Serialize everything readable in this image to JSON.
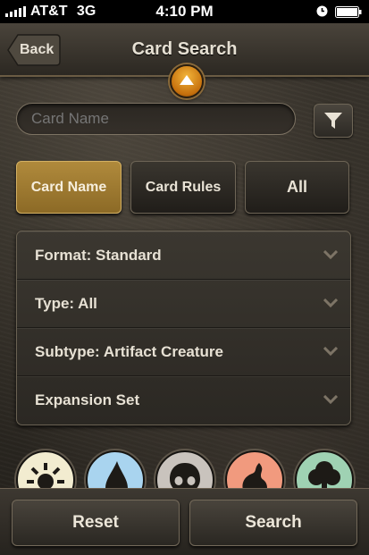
{
  "status_bar": {
    "carrier": "AT&T",
    "network": "3G",
    "time": "4:10 PM"
  },
  "nav": {
    "back_label": "Back",
    "title": "Card Search"
  },
  "search": {
    "placeholder": "Card Name"
  },
  "segments": [
    {
      "label": "Card Name",
      "selected": true
    },
    {
      "label": "Card Rules",
      "selected": false
    },
    {
      "label": "All",
      "selected": false
    }
  ],
  "filters": [
    {
      "label": "Format: Standard"
    },
    {
      "label": "Type: All"
    },
    {
      "label": "Subtype: Artifact Creature"
    },
    {
      "label": "Expansion Set"
    }
  ],
  "mana_colors": [
    {
      "name": "white-mana-icon",
      "color": "#f2ecd0"
    },
    {
      "name": "blue-mana-icon",
      "color": "#a9d4ef"
    },
    {
      "name": "black-mana-icon",
      "color": "#c9c3bd"
    },
    {
      "name": "red-mana-icon",
      "color": "#f19a7e"
    },
    {
      "name": "green-mana-icon",
      "color": "#9fd2b3"
    }
  ],
  "actions": {
    "reset_label": "Reset",
    "search_label": "Search"
  },
  "colors": {
    "accent": "#a8822f",
    "collapse_orange": "#e39a22"
  }
}
